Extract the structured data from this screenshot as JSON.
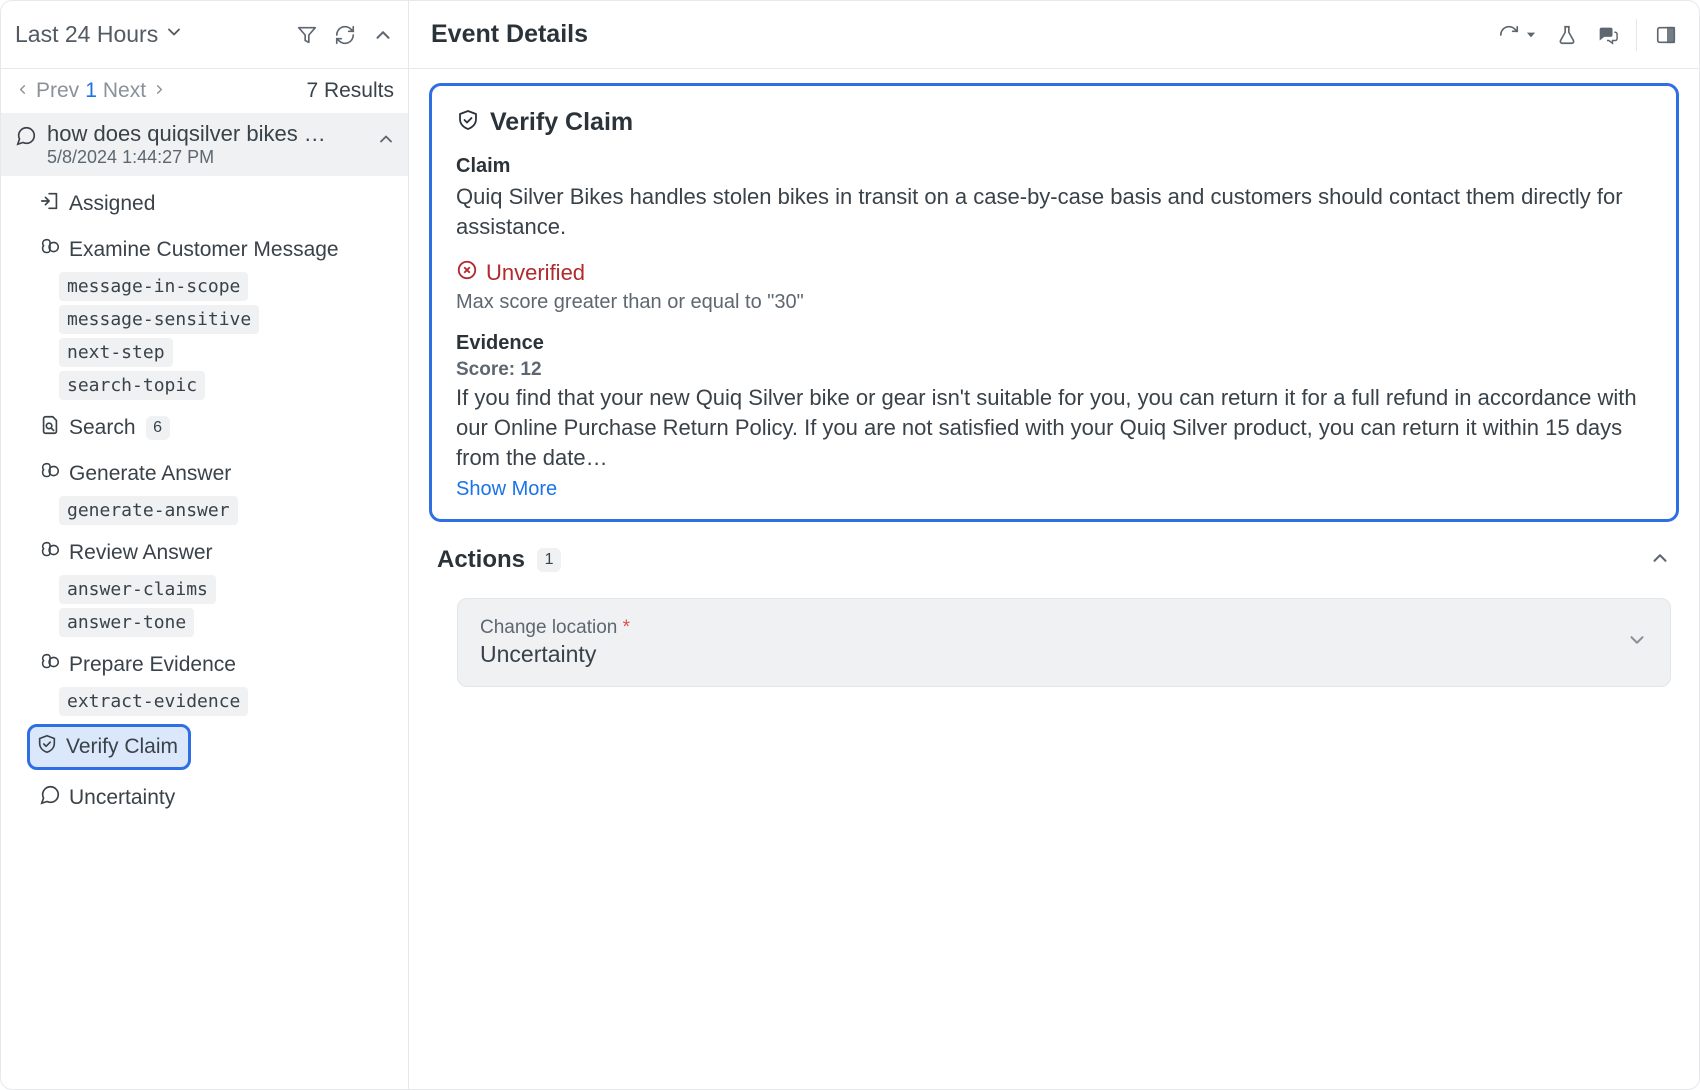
{
  "sidebar": {
    "range_label": "Last 24 Hours",
    "pager": {
      "prev": "Prev",
      "page": "1",
      "next": "Next",
      "results": "7 Results"
    },
    "event": {
      "title": "how does quiqsilver bikes …",
      "timestamp": "5/8/2024 1:44:27 PM"
    },
    "nodes": {
      "assigned": "Assigned",
      "examine": "Examine Customer Message",
      "examine_chips": [
        "message-in-scope",
        "message-sensitive",
        "next-step",
        "search-topic"
      ],
      "search": "Search",
      "search_count": "6",
      "generate": "Generate Answer",
      "generate_chip": "generate-answer",
      "review": "Review Answer",
      "review_chips": [
        "answer-claims",
        "answer-tone"
      ],
      "prepare": "Prepare Evidence",
      "prepare_chip": "extract-evidence",
      "verify": "Verify Claim",
      "uncertainty": "Uncertainty"
    }
  },
  "details": {
    "page_title": "Event Details",
    "verify": {
      "title": "Verify Claim",
      "claim_label": "Claim",
      "claim_text": "Quiq Silver Bikes handles stolen bikes in transit on a case-by-case basis and customers should contact them directly for assistance.",
      "status_label": "Unverified",
      "status_rule": "Max score greater than or equal to \"30\"",
      "evidence_label": "Evidence",
      "evidence_score": "Score: 12",
      "evidence_text": "If you find that your new Quiq Silver bike or gear isn't suitable for you, you can return it for a full refund in accordance with our Online Purchase Return Policy. If you are not satisfied with your Quiq Silver product, you can return it within 15 days from the date…",
      "show_more": "Show More"
    },
    "actions": {
      "title": "Actions",
      "count": "1",
      "form_label": "Change location ",
      "form_value": "Uncertainty"
    }
  }
}
